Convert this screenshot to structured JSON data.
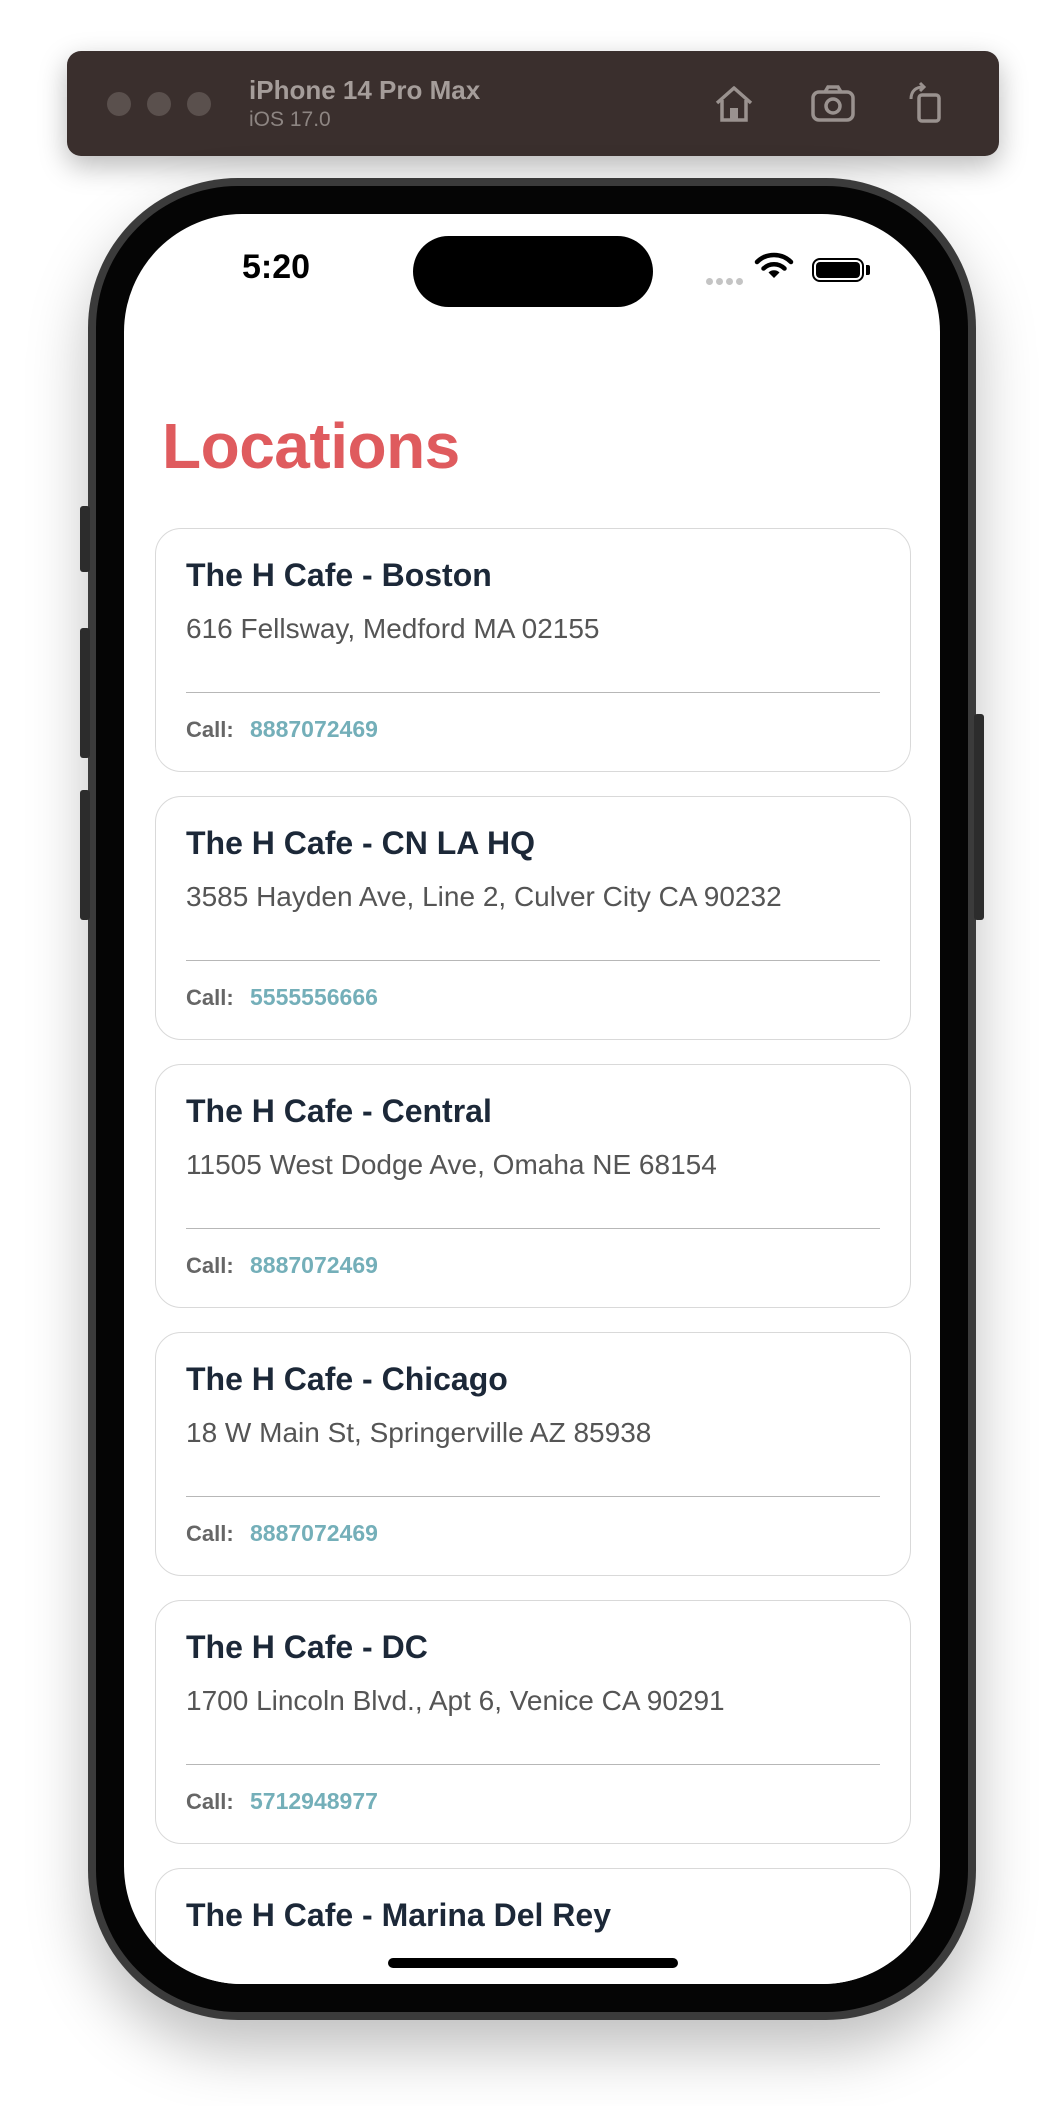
{
  "toolbar": {
    "device_name": "iPhone 14 Pro Max",
    "os_version": "iOS 17.0",
    "buttons": [
      "home-icon",
      "screenshot-icon",
      "rotate-icon"
    ]
  },
  "status_bar": {
    "time": "5:20"
  },
  "screen": {
    "title": "Locations",
    "title_color": "#df5b5e",
    "phone_color": "#74afb9",
    "call_label": "Call:",
    "locations": [
      {
        "name": "The H Cafe - Boston",
        "address": "616 Fellsway, Medford MA 02155",
        "phone": "8887072469"
      },
      {
        "name": "The H Cafe - CN LA HQ",
        "address": "3585 Hayden Ave, Line 2, Culver City CA 90232",
        "phone": "5555556666"
      },
      {
        "name": "The H Cafe - Central",
        "address": "11505 West Dodge Ave, Omaha NE 68154",
        "phone": "8887072469"
      },
      {
        "name": "The H Cafe - Chicago",
        "address": "18 W Main St, Springerville AZ 85938",
        "phone": "8887072469"
      },
      {
        "name": "The H Cafe - DC",
        "address": "1700 Lincoln Blvd., Apt 6, Venice CA 90291",
        "phone": "5712948977"
      },
      {
        "name": "The H Cafe - Marina Del Rey",
        "address": "",
        "phone": ""
      }
    ]
  }
}
